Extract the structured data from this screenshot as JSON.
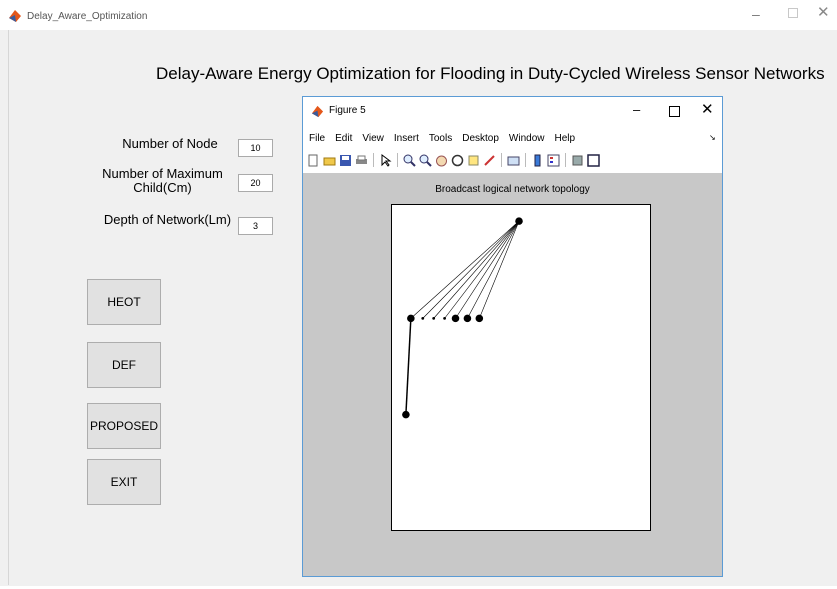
{
  "window": {
    "title": "Delay_Aware_Optimization",
    "min_symbol": "–",
    "close_symbol": "✕",
    "icon": "matlab-icon"
  },
  "heading": "Delay-Aware Energy Optimization for Flooding in Duty-Cycled Wireless Sensor Networks",
  "form": {
    "nodes_label": "Number of Node",
    "nodes_value": "10",
    "maxchild_label": "Number of Maximum Child(Cm)",
    "maxchild_value": "20",
    "depth_label": "Depth of Network(Lm)",
    "depth_value": "3"
  },
  "buttons": {
    "heot": "HEOT",
    "def": "DEF",
    "proposed": "PROPOSED",
    "exit": "EXIT"
  },
  "figure": {
    "title": "Figure 5",
    "min_symbol": "–",
    "close_symbol": "✕",
    "menu": [
      "File",
      "Edit",
      "View",
      "Insert",
      "Tools",
      "Desktop",
      "Window",
      "Help"
    ],
    "menu_arrow": "↘",
    "toolbar_icons": [
      "new-file-icon",
      "open-folder-icon",
      "save-icon",
      "print-icon",
      "pointer-icon",
      "zoom-in-icon",
      "zoom-out-icon",
      "pan-icon",
      "rotate-icon",
      "data-cursor-icon",
      "brush-icon",
      "link-icon",
      "colorbar-icon",
      "legend-icon",
      "hide-tools-icon",
      "show-tools-icon"
    ],
    "axes_title": "Broadcast  logical network topology",
    "colors": {
      "node": "#000000",
      "edge": "#000000",
      "axes_bg": "#ffffff",
      "canvas_bg": "#c8c8c8"
    }
  }
}
